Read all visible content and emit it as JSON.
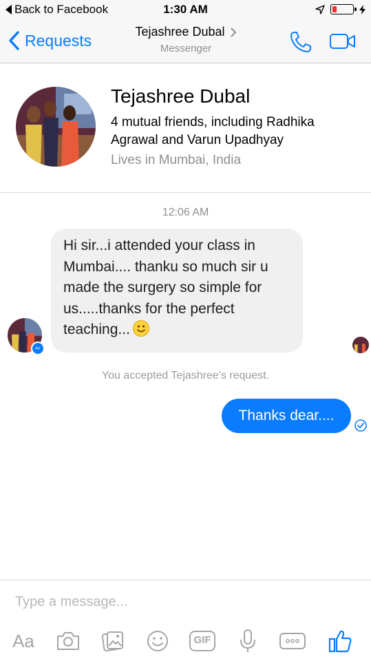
{
  "status_bar": {
    "back_label": "Back to Facebook",
    "time": "1:30 AM"
  },
  "header": {
    "back_label": "Requests",
    "title": "Tejashree Dubal",
    "subtitle": "Messenger",
    "accent_color": "#0a7cff"
  },
  "profile": {
    "name": "Tejashree Dubal",
    "mutual_friends": "4 mutual friends, including Radhika Agrawal and Varun Upadhyay",
    "location": "Lives in Mumbai, India"
  },
  "conversation": {
    "timestamp": "12:06 AM",
    "incoming_message": "Hi sir...i attended your class in Mumbai.... thanku so much sir u made the surgery so simple for us.....thanks for the perfect teaching...",
    "system_notice": "You accepted Tejashree's request.",
    "outgoing_message": "Thanks dear...."
  },
  "composer": {
    "placeholder": "Type a message...",
    "text_format_label": "Aa",
    "gif_label": "GIF",
    "tools": [
      "text-format-icon",
      "camera-icon",
      "photos-icon",
      "emoji-icon",
      "gif-icon",
      "microphone-icon",
      "more-icon",
      "like-icon"
    ]
  }
}
